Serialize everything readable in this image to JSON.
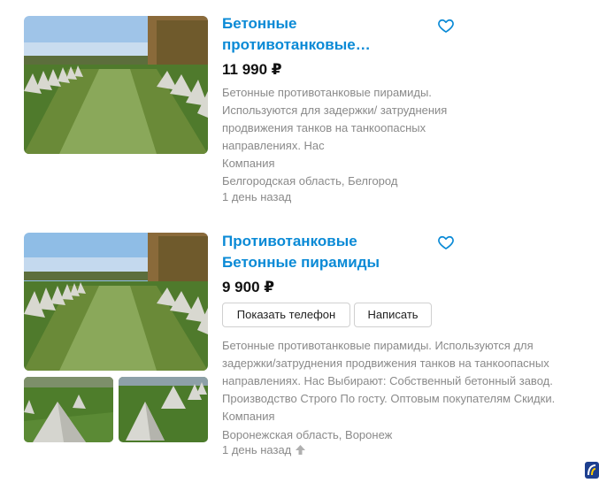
{
  "listings": [
    {
      "title": "Бетонные противотанковые…",
      "price": "11 990 ₽",
      "description": "Бетонные противотанковые пирамиды. Используются для задержки/ затруднения продвижения танков на танкоопасных направлениях. Нас",
      "seller": "Компания",
      "location": "Белгородская область, Белгород",
      "time": "1 день назад",
      "favorite_icon": "heart-outline-icon"
    },
    {
      "title_line1": "Противотанковые",
      "title_line2": "Бетонные пирамиды",
      "price": "9 900 ₽",
      "show_phone_label": "Показать телефон",
      "write_label": "Написать",
      "description": "Бетонные противотанковые пирамиды. Используются для задержки/затруднения продвижения танков на танкоопасных направлениях. Нас Выбирают: Собственный бетонный завод. Производство Строго По госту. Оптовым покупателям Скидки.",
      "seller": "Компания",
      "location": "Воронежская область, Воронеж",
      "time": "1 день назад",
      "favorite_icon": "heart-outline-icon",
      "raise_icon": "arrow-up-icon"
    }
  ],
  "colors": {
    "title": "#0a8ad6",
    "muted": "#8a8a8a",
    "price": "#111111"
  }
}
